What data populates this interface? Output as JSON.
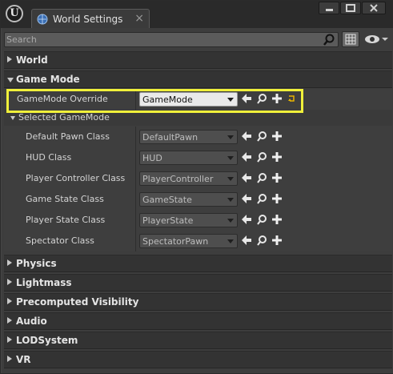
{
  "window": {
    "tab_title": "World Settings"
  },
  "search": {
    "placeholder": "Search"
  },
  "sections": {
    "world": "World",
    "game_mode": "Game Mode",
    "physics": "Physics",
    "lightmass": "Lightmass",
    "precomputed_visibility": "Precomputed Visibility",
    "audio": "Audio",
    "lod_system": "LODSystem",
    "vr": "VR"
  },
  "game_mode": {
    "override_label": "GameMode Override",
    "override_value": "GameMode",
    "selected_header": "Selected GameMode",
    "rows": [
      {
        "label": "Default Pawn Class",
        "value": "DefaultPawn"
      },
      {
        "label": "HUD Class",
        "value": "HUD"
      },
      {
        "label": "Player Controller Class",
        "value": "PlayerController"
      },
      {
        "label": "Game State Class",
        "value": "GameState"
      },
      {
        "label": "Player State Class",
        "value": "PlayerState"
      },
      {
        "label": "Spectator Class",
        "value": "SpectatorPawn"
      }
    ]
  },
  "colors": {
    "highlight": "#f0f03a",
    "background": "#3d3d3d",
    "header": "#333333"
  },
  "icons": [
    "unreal-logo-icon",
    "world-settings-icon",
    "close-icon",
    "minimize-icon",
    "maximize-icon",
    "search-icon",
    "view-options-icon",
    "eye-icon",
    "arrow-left-icon",
    "browse-icon",
    "add-icon",
    "reset-icon"
  ]
}
